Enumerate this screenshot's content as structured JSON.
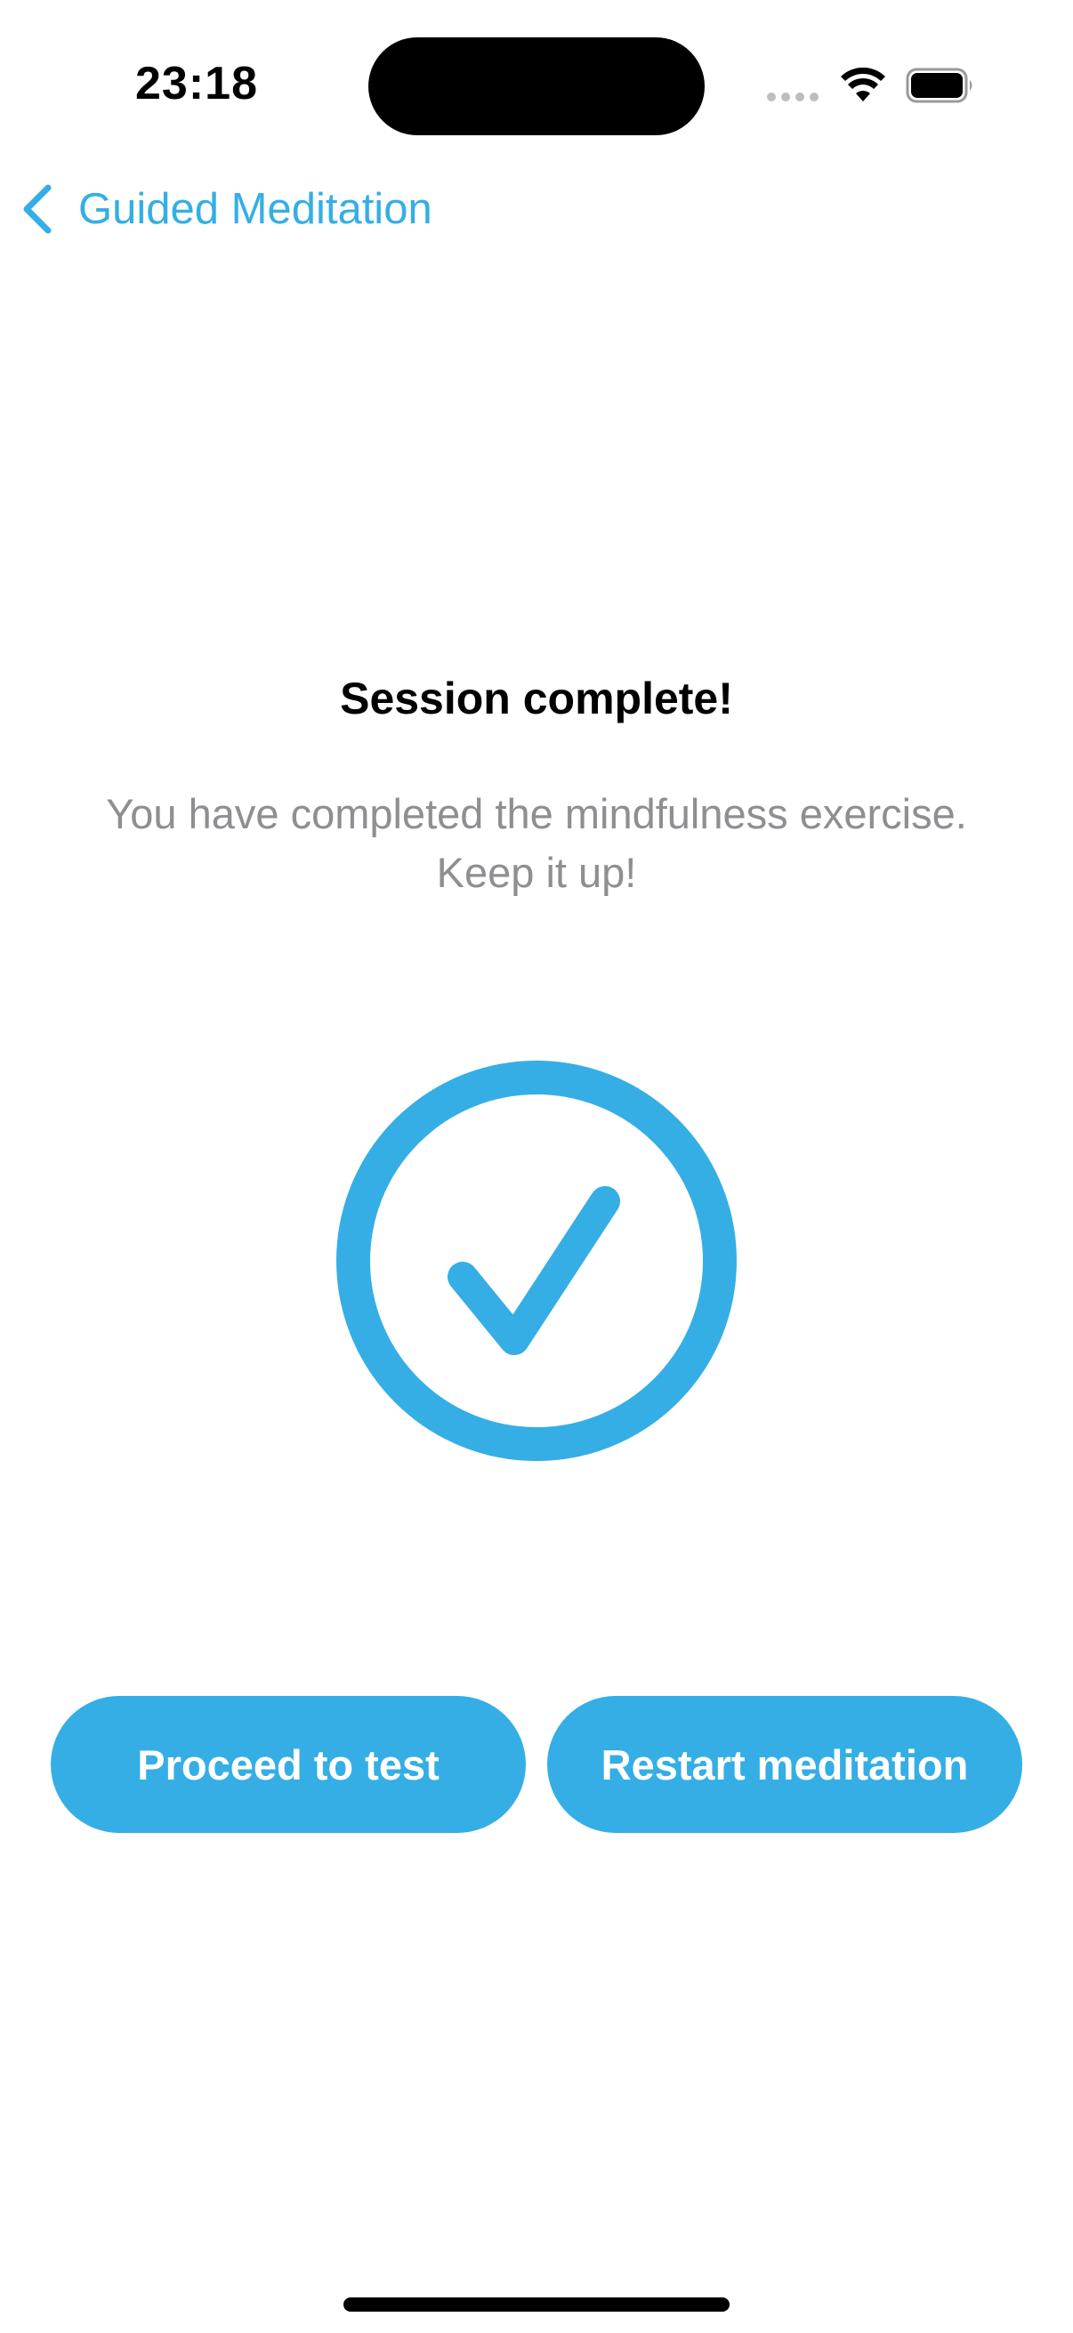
{
  "status_bar": {
    "time": "23:18",
    "signal_icon": "signal-dots-icon",
    "wifi_icon": "wifi-icon",
    "battery_icon": "battery-icon"
  },
  "nav": {
    "back_label": "Guided Meditation",
    "back_icon": "chevron-left-icon"
  },
  "main": {
    "title": "Session complete!",
    "subtitle_line1": "You have completed the mindfulness exercise.",
    "subtitle_line2": "Keep it up!",
    "status_icon": "checkmark-circle-icon"
  },
  "actions": {
    "proceed_label": "Proceed to test",
    "restart_label": "Restart meditation"
  },
  "colors": {
    "accent": "#35aee6",
    "secondary_text": "#8e8e93",
    "background": "#ffffff"
  }
}
